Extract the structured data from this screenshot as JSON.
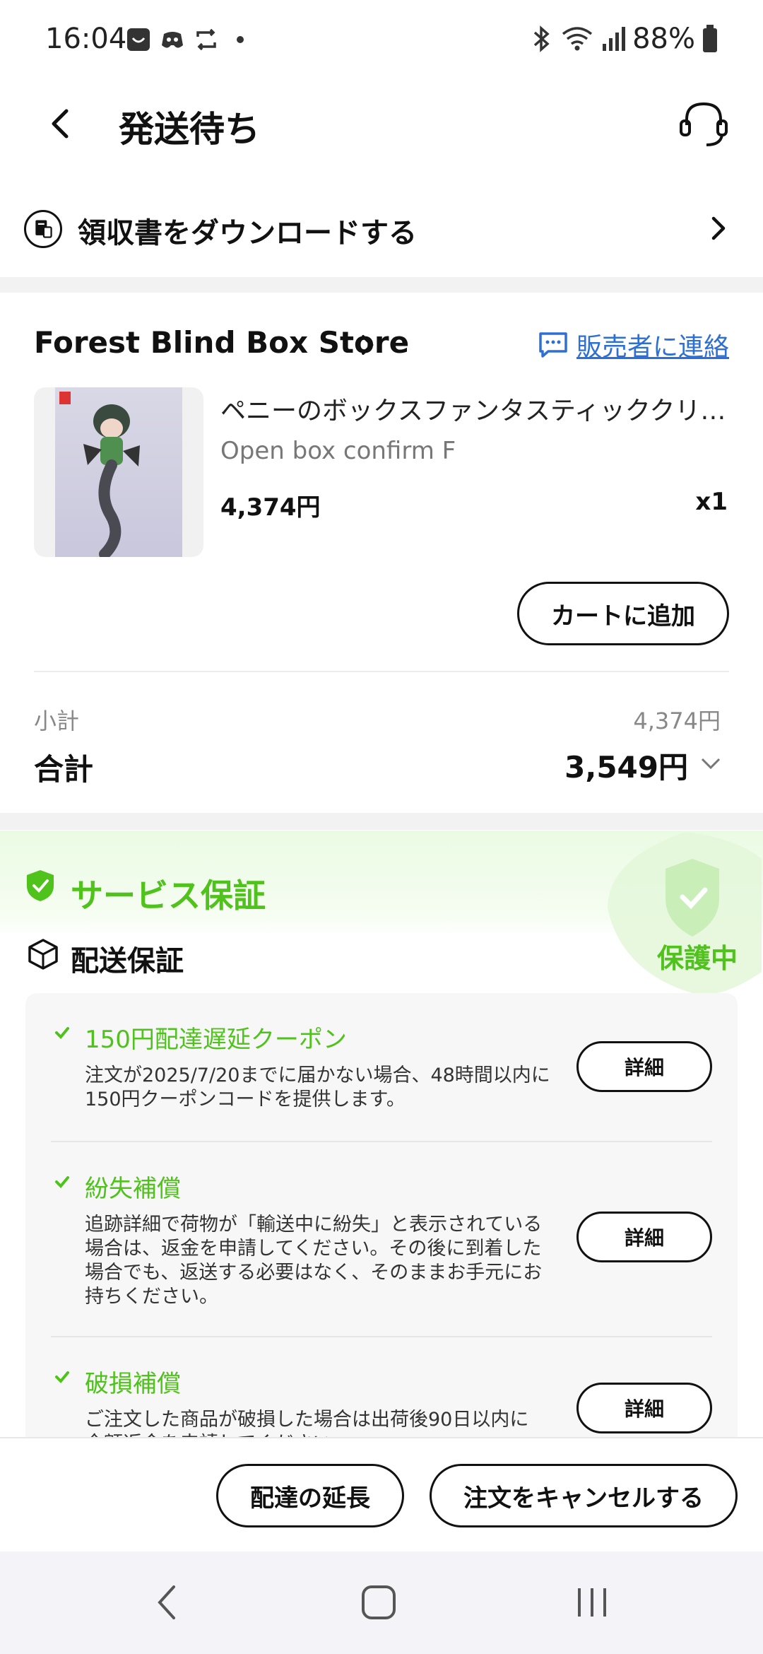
{
  "status_bar": {
    "time": "16:04",
    "battery": "88%",
    "icons_left": [
      "notification-icon",
      "discord-icon",
      "sync-icon",
      "dot-icon"
    ],
    "icons_right": [
      "bluetooth-icon",
      "wifi-icon",
      "signal-icon",
      "battery-icon"
    ]
  },
  "header": {
    "title": "発送待ち"
  },
  "receipt": {
    "label": "領収書をダウンロードする"
  },
  "store": {
    "name": "Forest Blind Box Store",
    "contact_label": "販売者に連絡"
  },
  "product": {
    "title": "ペニーのボックスファンタスティッククリー…",
    "variant": "Open box confirm F",
    "price": "4,374円",
    "quantity": "x1",
    "add_to_cart_label": "カートに追加"
  },
  "summary": {
    "subtotal_label": "小計",
    "subtotal_value": "4,374円",
    "total_label": "合計",
    "total_value": "3,549円"
  },
  "service": {
    "title": "サービス保証",
    "status": "保護中",
    "shipping_guarantee_label": "配送保証",
    "items": [
      {
        "title": "150円配達遅延クーポン",
        "desc_lines": [
          "注文が2025/7/20までに届かない場合、48時間以内に",
          "150円クーポンコードを提供します。"
        ],
        "button": "詳細"
      },
      {
        "title": "紛失補償",
        "desc_lines": [
          "追跡詳細で荷物が「輸送中に紛失」と表示されている",
          "場合は、返金を申請してください。その後に到着した",
          "場合でも、返送する必要はなく、そのままお手元にお",
          "持ちください。"
        ],
        "button": "詳細"
      },
      {
        "title": "破損補償",
        "desc_lines": [
          "ご注文した商品が破損した場合は出荷後90日以内に",
          "全額返金を申請してください。"
        ],
        "button": "詳細"
      }
    ]
  },
  "actions": {
    "extend_delivery": "配達の延長",
    "cancel_order": "注文をキャンセルする"
  },
  "colors": {
    "accent_green": "#4fc21b",
    "link_blue": "#2e6fd6"
  }
}
